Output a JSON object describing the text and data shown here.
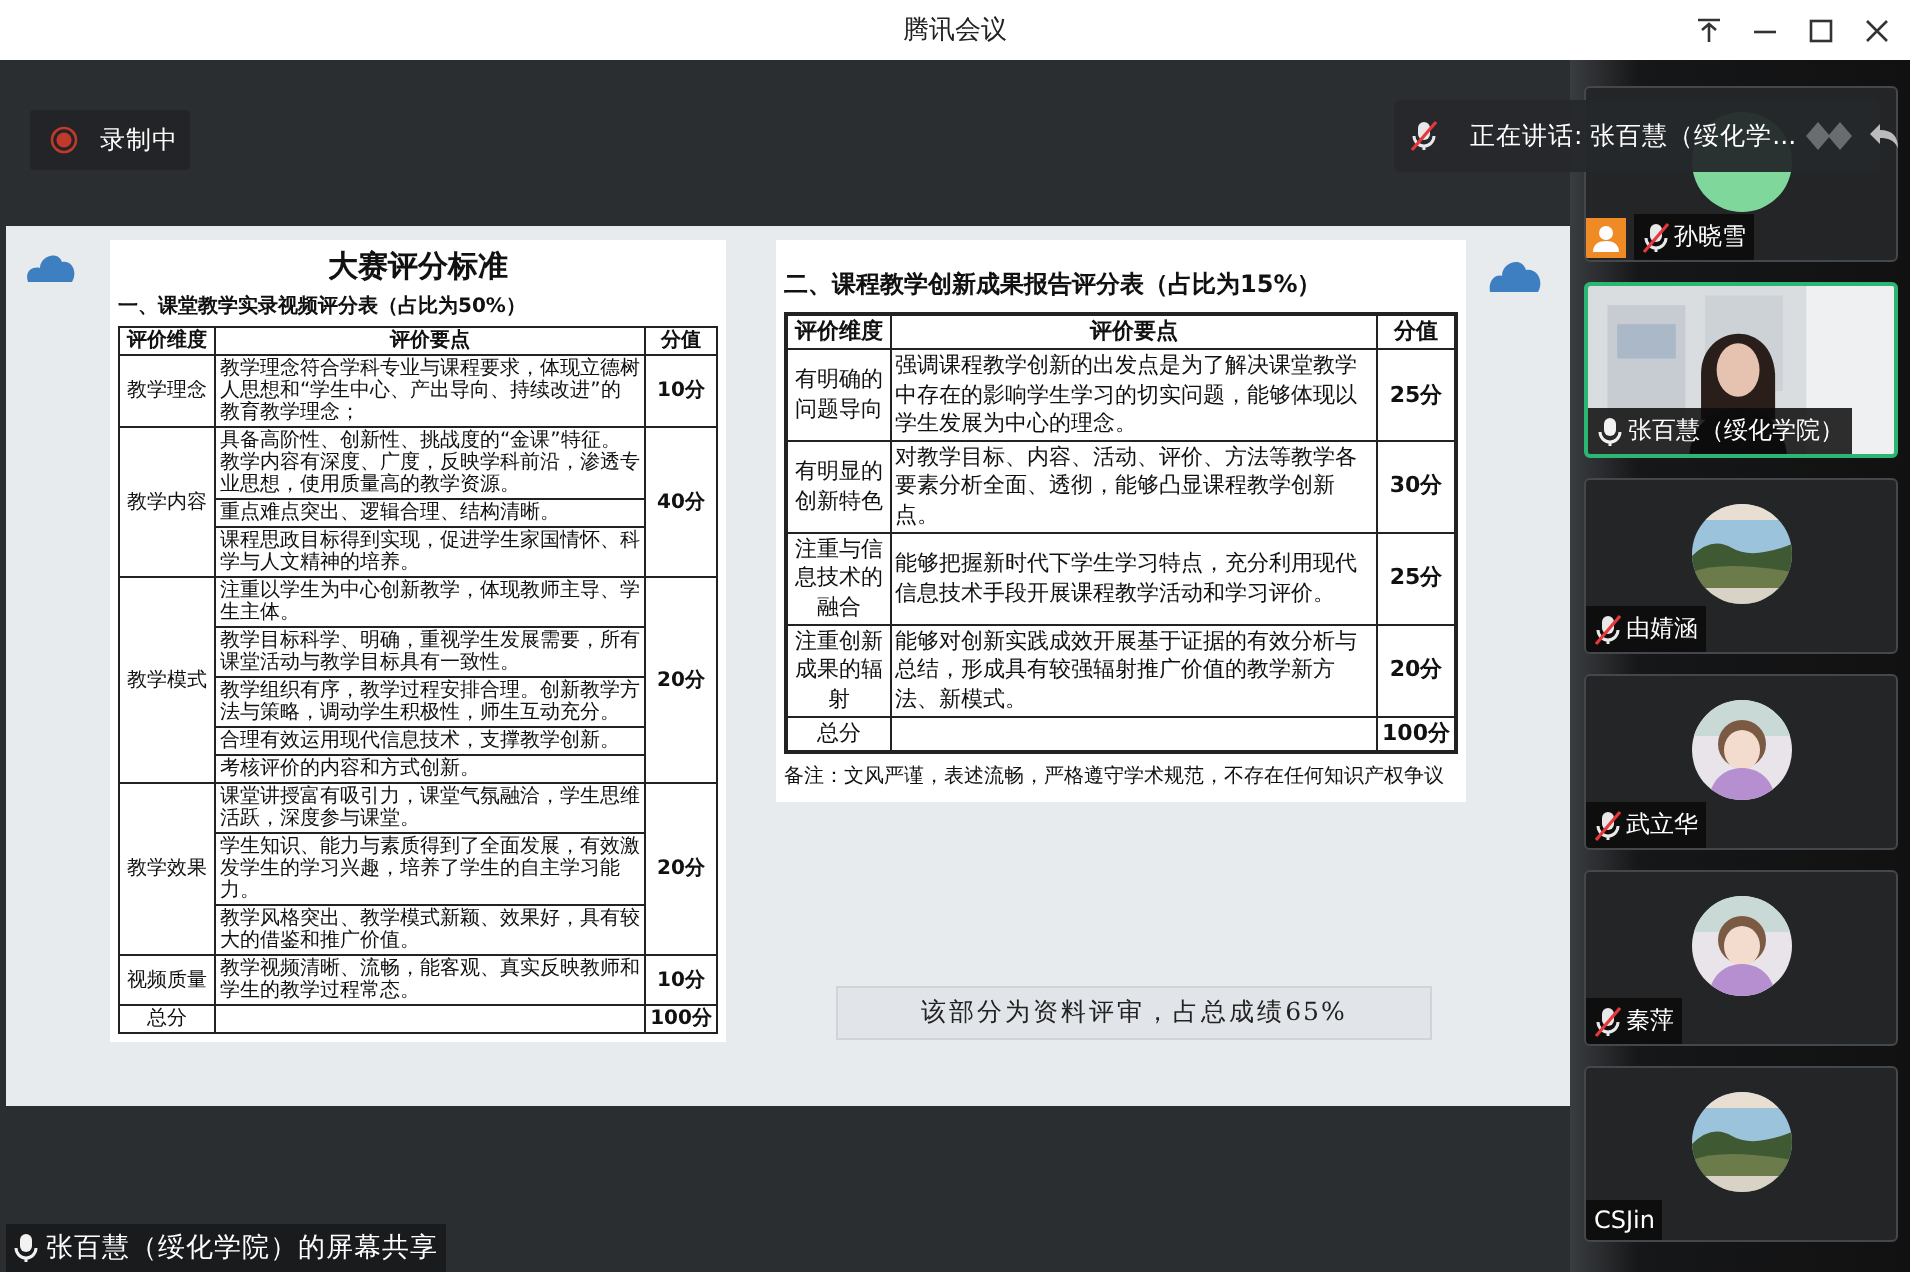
{
  "window": {
    "title": "腾讯会议"
  },
  "recording": {
    "label": "录制中"
  },
  "speaking": {
    "muted": true,
    "label": "正在讲话: 张百慧（绥化学..."
  },
  "slide": {
    "left_page": {
      "title": "大赛评分标准",
      "subtitle": "一、课堂教学实录视频评分表（占比为50%）",
      "columns": [
        "评价维度",
        "评价要点",
        "分值"
      ],
      "rows": [
        {
          "dimension": "教学理念",
          "points": [
            "教学理念符合学科专业与课程要求，体现立德树人思想和“学生中心、产出导向、持续改进”的教育教学理念；"
          ],
          "score": "10分"
        },
        {
          "dimension": "教学内容",
          "points": [
            "具备高阶性、创新性、挑战度的“金课”特征。教学内容有深度、广度，反映学科前沿，渗透专业思想，使用质量高的教学资源。",
            "重点难点突出、逻辑合理、结构清晰。",
            "课程思政目标得到实现，促进学生家国情怀、科学与人文精神的培养。"
          ],
          "score": "40分"
        },
        {
          "dimension": "教学模式",
          "points": [
            "注重以学生为中心创新教学，体现教师主导、学生主体。",
            "教学目标科学、明确，重视学生发展需要，所有课堂活动与教学目标具有一致性。",
            "教学组织有序，教学过程安排合理。创新教学方法与策略，调动学生积极性，师生互动充分。",
            "合理有效运用现代信息技术，支撑教学创新。",
            "考核评价的内容和方式创新。"
          ],
          "score": "20分"
        },
        {
          "dimension": "教学效果",
          "points": [
            "课堂讲授富有吸引力，课堂气氛融洽，学生思维活跃，深度参与课堂。",
            "学生知识、能力与素质得到了全面发展，有效激发学生的学习兴趣，培养了学生的自主学习能力。",
            "教学风格突出、教学模式新颖、效果好，具有较大的借鉴和推广价值。"
          ],
          "score": "20分"
        },
        {
          "dimension": "视频质量",
          "points": [
            "教学视频清晰、流畅，能客观、真实反映教师和学生的教学过程常态。"
          ],
          "score": "10分"
        }
      ],
      "total": {
        "label": "总分",
        "score": "100分"
      }
    },
    "right_page": {
      "title": "二、课程教学创新成果报告评分表（占比为15%）",
      "columns": [
        "评价维度",
        "评价要点",
        "分值"
      ],
      "rows": [
        {
          "dimension": "有明确的问题导向",
          "points": [
            "强调课程教学创新的出发点是为了解决课堂教学中存在的影响学生学习的切实问题，能够体现以学生发展为中心的理念。"
          ],
          "score": "25分"
        },
        {
          "dimension": "有明显的创新特色",
          "points": [
            "对教学目标、内容、活动、评价、方法等教学各要素分析全面、透彻，能够凸显课程教学创新点。"
          ],
          "score": "30分"
        },
        {
          "dimension": "注重与信息技术的融合",
          "points": [
            "能够把握新时代下学生学习特点，充分利用现代信息技术手段开展课程教学活动和学习评价。"
          ],
          "score": "25分"
        },
        {
          "dimension": "注重创新成果的辐射",
          "points": [
            "能够对创新实践成效开展基于证据的有效分析与总结，形成具有较强辐射推广价值的教学新方法、新模式。"
          ],
          "score": "20分"
        }
      ],
      "total": {
        "label": "总分",
        "score": "100分"
      },
      "note": "备注：文风严谨，表述流畅，严格遵守学术规范，不存在任何知识产权争议"
    },
    "summary": "该部分为资料评审，占总成绩65%"
  },
  "participants": [
    {
      "name": "孙晓雪",
      "muted": true,
      "kind": "plain",
      "badge": true,
      "selected": false
    },
    {
      "name": "张百慧（绥化学院）",
      "muted": false,
      "kind": "video",
      "badge": false,
      "selected": true
    },
    {
      "name": "由婧涵",
      "muted": true,
      "kind": "picture",
      "badge": false,
      "selected": false
    },
    {
      "name": "武立华",
      "muted": true,
      "kind": "figure",
      "badge": false,
      "selected": false
    },
    {
      "name": "秦萍",
      "muted": true,
      "kind": "figure",
      "badge": false,
      "selected": false
    },
    {
      "name": "CSJin",
      "kind": "picture",
      "badge": false,
      "selected": false
    }
  ],
  "share_label": {
    "muted": false,
    "text": "张百慧（绥化学院）的屏幕共享"
  }
}
